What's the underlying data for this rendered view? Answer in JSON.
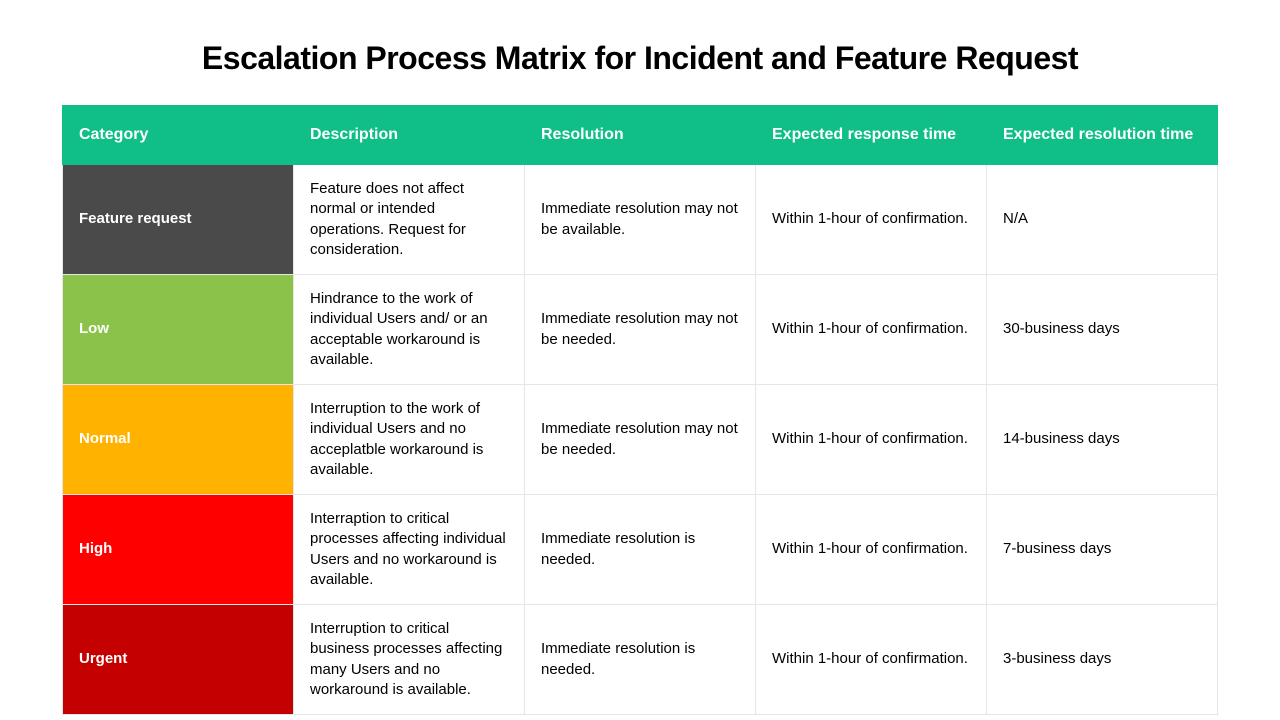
{
  "title": "Escalation Process Matrix for Incident and Feature Request",
  "headers": {
    "category": "Category",
    "description": "Description",
    "resolution": "Resolution",
    "response_time": "Expected response time",
    "resolution_time": "Expected resolution time"
  },
  "rows": [
    {
      "category": "Feature request",
      "description": "Feature does not affect normal or intended operations. Request for consideration.",
      "resolution": "Immediate resolution may not be available.",
      "response_time": "Within 1-hour of confirmation.",
      "resolution_time": "N/A"
    },
    {
      "category": "Low",
      "description": "Hindrance to the work of individual Users and/ or an acceptable workaround is available.",
      "resolution": "Immediate resolution may not be needed.",
      "response_time": "Within 1-hour of confirmation.",
      "resolution_time": "30-business days"
    },
    {
      "category": "Normal",
      "description": "Interruption to the work of individual Users and no acceplatble workaround is available.",
      "resolution": "Immediate resolution may not be needed.",
      "response_time": "Within 1-hour of confirmation.",
      "resolution_time": "14-business days"
    },
    {
      "category": "High",
      "description": "Interraption to critical processes affecting individual Users and no workaround is available.",
      "resolution": "Immediate resolution is needed.",
      "response_time": "Within 1-hour of confirmation.",
      "resolution_time": "7-business days"
    },
    {
      "category": "Urgent",
      "description": "Interruption to critical business processes affecting many Users and no workaround is available.",
      "resolution": "Immediate resolution is needed.",
      "response_time": "Within 1-hour of confirmation.",
      "resolution_time": "3-business days"
    }
  ],
  "chart_data": {
    "type": "table",
    "columns": [
      "Category",
      "Description",
      "Resolution",
      "Expected response time",
      "Expected resolution time"
    ],
    "rows": [
      [
        "Feature request",
        "Feature does not affect normal or intended operations. Request for consideration.",
        "Immediate resolution may not be available.",
        "Within 1-hour of confirmation.",
        "N/A"
      ],
      [
        "Low",
        "Hindrance to the work of individual Users and/ or an acceptable workaround is available.",
        "Immediate resolution may not be needed.",
        "Within 1-hour of confirmation.",
        "30-business days"
      ],
      [
        "Normal",
        "Interruption to the work of individual Users and no acceplatble workaround is available.",
        "Immediate resolution may not be needed.",
        "Within 1-hour of confirmation.",
        "14-business days"
      ],
      [
        "High",
        "Interraption to critical processes affecting individual Users and no workaround is available.",
        "Immediate resolution is needed.",
        "Within 1-hour of confirmation.",
        "7-business days"
      ],
      [
        "Urgent",
        "Interruption to critical business processes affecting many Users and no workaround is available.",
        "Immediate resolution is needed.",
        "Within 1-hour of confirmation.",
        "3-business days"
      ]
    ]
  }
}
